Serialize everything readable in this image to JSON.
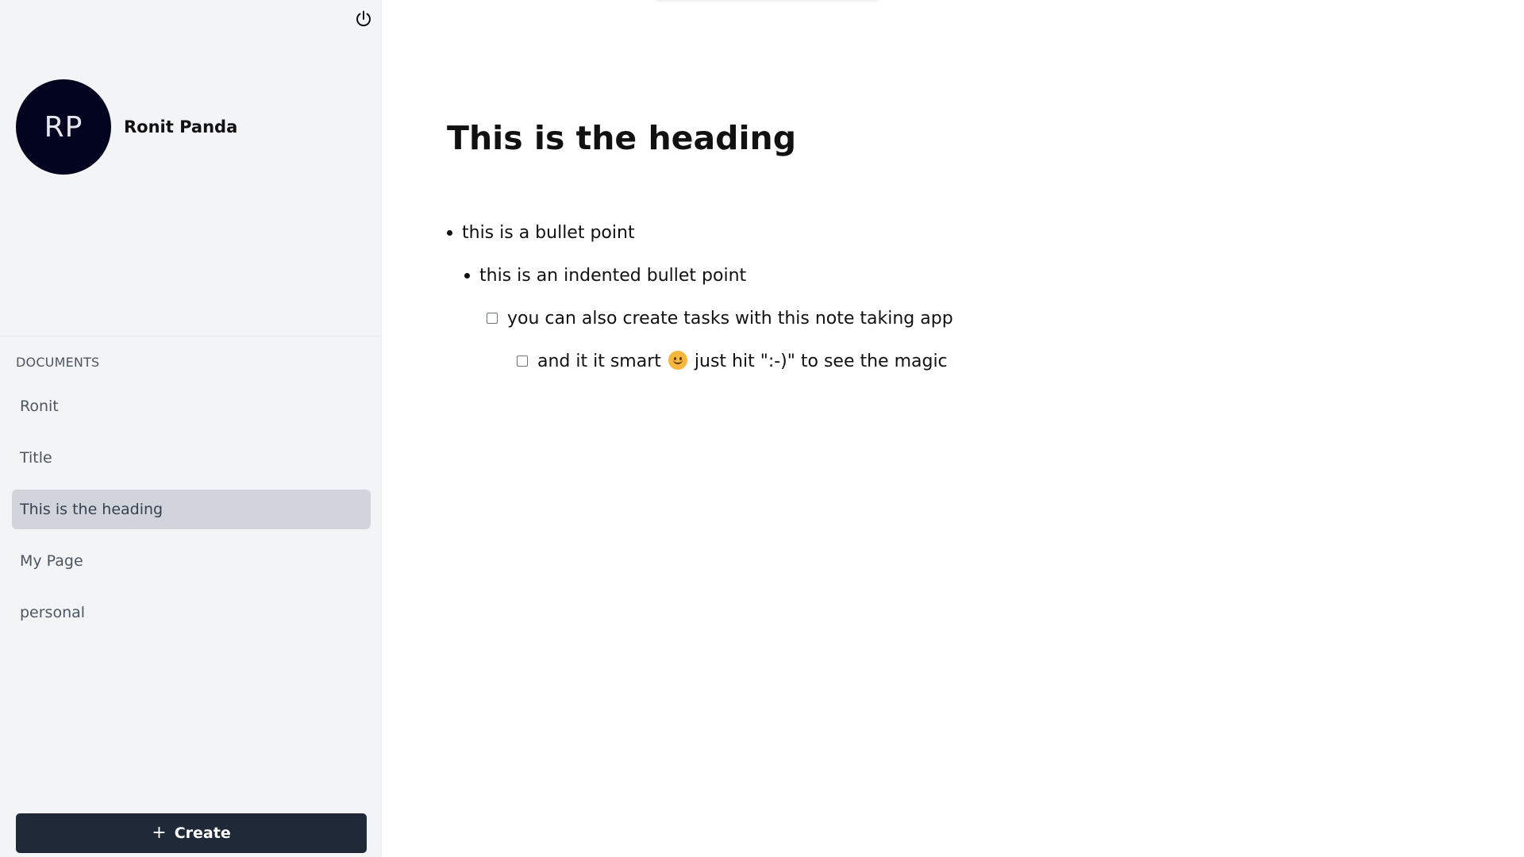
{
  "user": {
    "initials": "RP",
    "name": "Ronit Panda"
  },
  "sidebar": {
    "section_label": "DOCUMENTS",
    "documents": [
      {
        "label": "Ronit",
        "active": false
      },
      {
        "label": "Title",
        "active": false
      },
      {
        "label": "This is the heading",
        "active": true
      },
      {
        "label": "My Page",
        "active": false
      },
      {
        "label": "personal",
        "active": false
      }
    ],
    "create_label": "Create",
    "power_icon": "power-icon",
    "create_icon": "plus-icon"
  },
  "document": {
    "heading": "This is the heading",
    "blocks": [
      {
        "type": "bullet",
        "text": "this is a bullet point"
      },
      {
        "type": "bullet",
        "text": "this is an indented bullet point"
      },
      {
        "type": "task",
        "text": "you can also create tasks with this note taking app",
        "checked": false
      },
      {
        "type": "task",
        "text_before": "and it it smart",
        "emoji": "slightly-smiling-face",
        "text_after": "just hit \":-)\" to see the magic",
        "checked": false
      }
    ]
  },
  "colors": {
    "sidebar_bg": "#f3f4f6",
    "avatar_bg": "#030520",
    "active_item_bg": "#d1d5db",
    "create_button_bg": "#1f2937",
    "emoji": "#f6b73c"
  }
}
